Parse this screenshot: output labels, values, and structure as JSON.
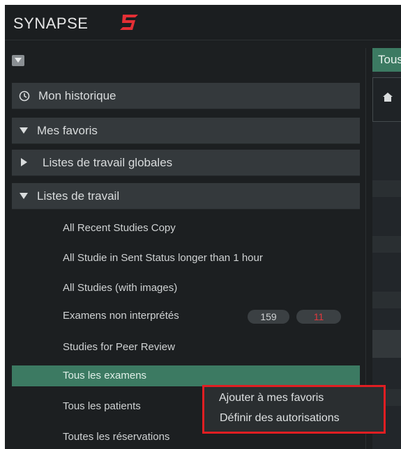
{
  "app": {
    "logo_text": "SYNAPSE",
    "logo_mark": "5"
  },
  "sidebar": {
    "sections": [
      {
        "label": "Mon historique",
        "icon": "history-icon"
      },
      {
        "label": "Mes favoris",
        "icon": "triangle-down-icon"
      },
      {
        "label": "Listes de travail globales",
        "icon": "triangle-right-icon"
      },
      {
        "label": "Listes de travail",
        "icon": "triangle-down-icon"
      }
    ],
    "worklists": [
      {
        "label": "All Recent Studies Copy"
      },
      {
        "label": "All Studie  in Sent Status longer than 1 hour"
      },
      {
        "label": "All Studies (with images)"
      },
      {
        "label": "Examens non interprétés",
        "count": "159",
        "alert": "11"
      },
      {
        "label": "Studies for Peer Review"
      },
      {
        "label": "Tous les examens",
        "selected": true
      },
      {
        "label": "Tous les patients"
      },
      {
        "label": "Toutes les réservations"
      }
    ]
  },
  "right_pane": {
    "tab_label": "Tous"
  },
  "context_menu": {
    "items": [
      "Ajouter à mes favoris",
      "Définir des autorisations"
    ],
    "highlight_color": "#e01e22"
  },
  "colors": {
    "accent": "#3c7a62",
    "alert": "#e0383d",
    "brand_mark": "#e52f35"
  }
}
